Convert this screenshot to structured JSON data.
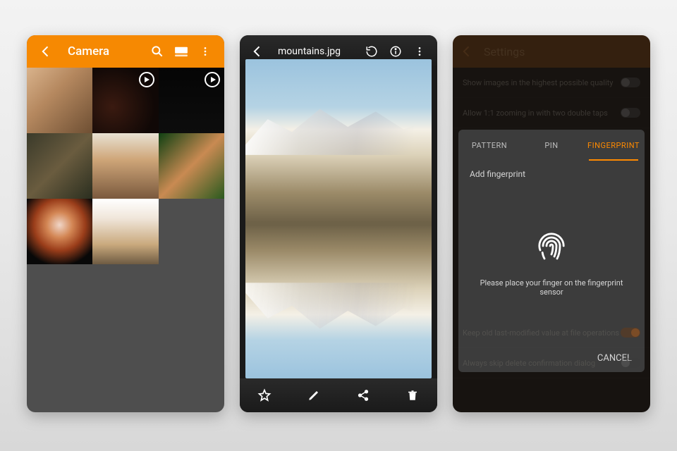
{
  "colors": {
    "accent": "#f68902",
    "orange_dark": "#ff8a00",
    "dark": "#1a1a1a",
    "gray": "#4e4e4e"
  },
  "phone1": {
    "title": "Camera",
    "icons": {
      "back": "arrow-left",
      "search": "search",
      "view": "view-grid",
      "menu": "more-vert"
    },
    "thumbs": [
      {
        "kind": "photo",
        "name": "mother-child"
      },
      {
        "kind": "video",
        "name": "dark-scene-1"
      },
      {
        "kind": "video",
        "name": "dark-scene-2"
      },
      {
        "kind": "photo",
        "name": "brunette-outdoor"
      },
      {
        "kind": "photo",
        "name": "brunette-field"
      },
      {
        "kind": "photo",
        "name": "woman-palms"
      },
      {
        "kind": "photo",
        "name": "redhead-portrait"
      },
      {
        "kind": "photo",
        "name": "woman-braids"
      }
    ]
  },
  "phone2": {
    "filename": "mountains.jpg",
    "top_icons": {
      "back": "arrow-left",
      "rotate": "rotate",
      "info": "info",
      "menu": "more-vert"
    },
    "bottom_icons": {
      "favorite": "star-outline",
      "edit": "pencil",
      "share": "share",
      "delete": "trash"
    }
  },
  "phone3": {
    "title": "Settings",
    "settings": [
      {
        "label": "Show images in the highest possible quality",
        "on": false
      },
      {
        "label": "Allow 1:1 zooming in with two double taps",
        "on": false
      },
      {
        "label": "Keep old last-modified value at file operations",
        "on": true
      },
      {
        "label": "Always skip delete confirmation dialog",
        "on": false
      }
    ],
    "modal": {
      "tabs": [
        "PATTERN",
        "PIN",
        "FINGERPRINT"
      ],
      "active_tab": 2,
      "add_label": "Add fingerprint",
      "instruction": "Please place your finger on the fingerprint sensor",
      "cancel": "CANCEL"
    }
  }
}
